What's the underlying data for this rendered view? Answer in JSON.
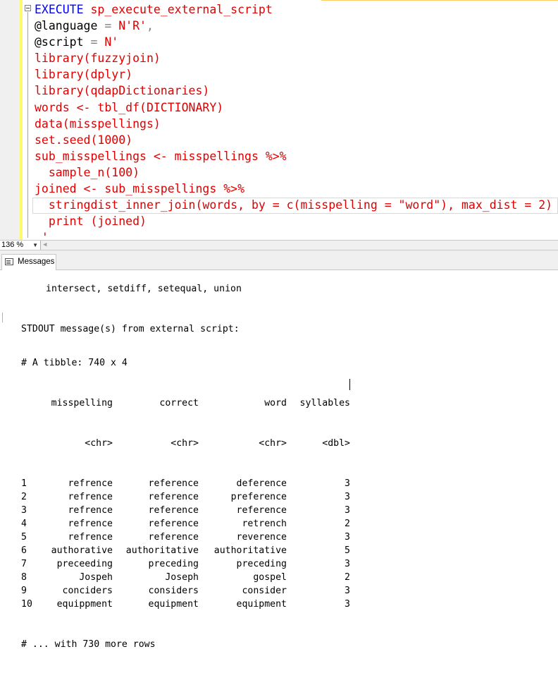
{
  "editor": {
    "lines": [
      {
        "parts": [
          {
            "t": "EXECUTE",
            "c": "kw"
          },
          {
            "t": " sp_execute_external_script",
            "c": "str"
          }
        ]
      },
      {
        "parts": [
          {
            "t": "@language",
            "c": "pl"
          },
          {
            "t": " = ",
            "c": "op"
          },
          {
            "t": "N'R'",
            "c": "str"
          },
          {
            "t": ",",
            "c": "op"
          }
        ]
      },
      {
        "parts": [
          {
            "t": "@script",
            "c": "pl"
          },
          {
            "t": " = ",
            "c": "op"
          },
          {
            "t": "N'",
            "c": "str"
          }
        ]
      },
      {
        "parts": [
          {
            "t": "library(fuzzyjoin)",
            "c": "str"
          }
        ]
      },
      {
        "parts": [
          {
            "t": "library(dplyr)",
            "c": "str"
          }
        ]
      },
      {
        "parts": [
          {
            "t": "library(qdapDictionaries)",
            "c": "str"
          }
        ]
      },
      {
        "parts": [
          {
            "t": "words <- tbl_df(DICTIONARY)",
            "c": "str"
          }
        ]
      },
      {
        "parts": [
          {
            "t": "data(misspellings)",
            "c": "str"
          }
        ]
      },
      {
        "parts": [
          {
            "t": "set.seed(1000)",
            "c": "str"
          }
        ]
      },
      {
        "parts": [
          {
            "t": "sub_misspellings <- misspellings %>%",
            "c": "str"
          }
        ]
      },
      {
        "parts": [
          {
            "t": "  sample_n(100)",
            "c": "str"
          }
        ]
      },
      {
        "parts": [
          {
            "t": "joined <- sub_misspellings %>%",
            "c": "str"
          }
        ]
      },
      {
        "parts": [
          {
            "t": "  stringdist_inner_join(words, by = c(misspelling = \"word\"), max_dist = 2)",
            "c": "str"
          }
        ]
      },
      {
        "parts": [
          {
            "t": "  print (joined)",
            "c": "str"
          }
        ]
      },
      {
        "parts": [
          {
            "t": " '",
            "c": "str"
          }
        ]
      }
    ]
  },
  "zoom": {
    "value": "136 %"
  },
  "tabs": [
    {
      "label": "Messages"
    }
  ],
  "messages": {
    "intersect_line": "intersect, setdiff, setequal, union",
    "stdout_header": "STDOUT message(s) from external script:",
    "tibble_header": "# A tibble: 740 x 4",
    "columns": [
      "misspelling",
      "correct",
      "word",
      "syllables"
    ],
    "types": [
      "<chr>",
      "<chr>",
      "<chr>",
      "<dbl>"
    ],
    "rows": [
      {
        "idx": "1",
        "misspelling": "refrence",
        "correct": "reference",
        "word": "deference",
        "syllables": "3"
      },
      {
        "idx": "2",
        "misspelling": "refrence",
        "correct": "reference",
        "word": "preference",
        "syllables": "3"
      },
      {
        "idx": "3",
        "misspelling": "refrence",
        "correct": "reference",
        "word": "reference",
        "syllables": "3"
      },
      {
        "idx": "4",
        "misspelling": "refrence",
        "correct": "reference",
        "word": "retrench",
        "syllables": "2"
      },
      {
        "idx": "5",
        "misspelling": "refrence",
        "correct": "reference",
        "word": "reverence",
        "syllables": "3"
      },
      {
        "idx": "6",
        "misspelling": "authorative",
        "correct": "authoritative",
        "word": "authoritative",
        "syllables": "5"
      },
      {
        "idx": "7",
        "misspelling": "preceeding",
        "correct": "preceding",
        "word": "preceding",
        "syllables": "3"
      },
      {
        "idx": "8",
        "misspelling": "Jospeh",
        "correct": "Joseph",
        "word": "gospel",
        "syllables": "2"
      },
      {
        "idx": "9",
        "misspelling": "conciders",
        "correct": "considers",
        "word": "consider",
        "syllables": "3"
      },
      {
        "idx": "10",
        "misspelling": "equippment",
        "correct": "equipment",
        "word": "equipment",
        "syllables": "3"
      }
    ],
    "footer_partial": "# ... with 730 more rows"
  }
}
